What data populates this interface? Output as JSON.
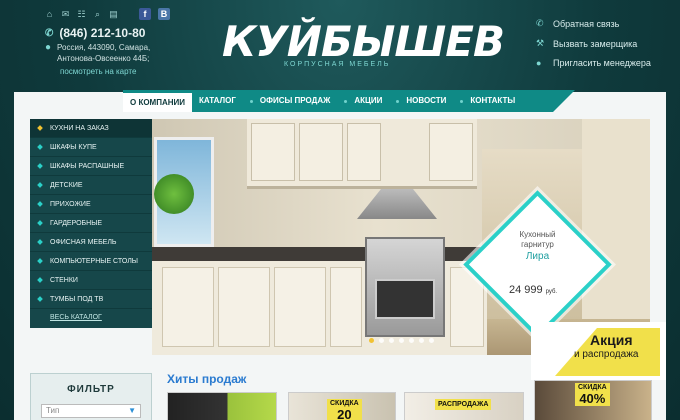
{
  "header": {
    "phone": "(846) 212-10-80",
    "address_line1": "Россия, 443090, Самара,",
    "address_line2": "Антонова-Овсеенко 44Б;",
    "map_link": "посмотреть на карте",
    "logo_text": "КУЙБЫШЕВ",
    "logo_tagline": "КОРПУСНАЯ МЕБЕЛЬ",
    "right_links": [
      "Обратная связь",
      "Вызвать замерщика",
      "Пригласить менеджера"
    ]
  },
  "nav": {
    "items": [
      "О КОМПАНИИ",
      "КАТАЛОГ",
      "ОФИСЫ ПРОДАЖ",
      "АКЦИИ",
      "НОВОСТИ",
      "КОНТАКТЫ"
    ]
  },
  "sidebar": {
    "items": [
      "КУХНИ НА ЗАКАЗ",
      "ШКАФЫ КУПЕ",
      "ШКАФЫ РАСПАШНЫЕ",
      "ДЕТСКИЕ",
      "ПРИХОЖИЕ",
      "ГАРДЕРОБНЫЕ",
      "ОФИСНАЯ МЕБЕЛЬ",
      "КОМПЬЮТЕРНЫЕ СТОЛЫ",
      "СТЕНКИ",
      "ТУМБЫ ПОД ТВ"
    ],
    "all": "ВЕСЬ КАТАЛОГ"
  },
  "hero": {
    "product_type": "Кухонный",
    "product_type2": "гарнитур",
    "product_name": "Лира",
    "price": "24 999",
    "currency": "руб."
  },
  "promo": {
    "title": "Акция",
    "subtitle": "и распродажа"
  },
  "filter": {
    "title": "ФИЛЬТР",
    "select_value": "Тип"
  },
  "bestsellers": {
    "title": "Хиты продаж",
    "badge1_label": "СКИДКА",
    "badge1_value": "20",
    "badge2_label": "РАСПРОДАЖА",
    "badge3_label": "СКИДКА",
    "badge3_value": "40%"
  },
  "colors": {
    "accent": "#0f8a86",
    "background": "#0f3a3c",
    "promo_yellow": "#f1e04a",
    "link_blue": "#2a7bd0"
  }
}
